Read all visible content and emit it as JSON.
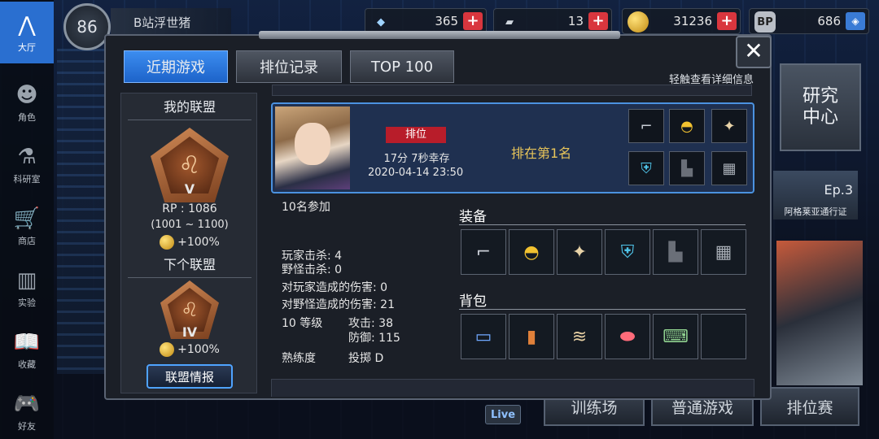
{
  "nav": [
    {
      "label": "大厅",
      "icon": "a-logo-icon",
      "active": true
    },
    {
      "label": "角色",
      "icon": "character-icon"
    },
    {
      "label": "科研室",
      "icon": "flask-icon"
    },
    {
      "label": "商店",
      "icon": "cart-icon"
    },
    {
      "label": "实验",
      "icon": "books-icon"
    },
    {
      "label": "收藏",
      "icon": "book-open-icon"
    },
    {
      "label": "好友",
      "icon": "gamepad-icon"
    }
  ],
  "header": {
    "level": "86",
    "username": "B站浮世猪",
    "resources": [
      {
        "icon": "ticket-icon",
        "value": "365"
      },
      {
        "icon": "card-icon",
        "value": "13"
      },
      {
        "icon": "gold-coin-icon",
        "value": "31236"
      },
      {
        "icon": "bp-icon",
        "value": "686"
      }
    ]
  },
  "background": {
    "research_center": "研究\n中心",
    "episode": "Ep.3",
    "episode_caption": "阿格莱亚通行证",
    "bottom_buttons": [
      "训练场",
      "普通游戏",
      "排位赛"
    ],
    "live": "Live"
  },
  "modal": {
    "tabs": [
      "近期游戏",
      "排位记录",
      "TOP 100"
    ],
    "active_tab": 0,
    "hint": "轻触查看详细信息",
    "close": "✕"
  },
  "league": {
    "my_title": "我的联盟",
    "my_tier": "V",
    "rp": "RP : 1086",
    "rp_range": "(1001 ~ 1100)",
    "my_bonus": "+100%",
    "next_title": "下个联盟",
    "next_tier": "IV",
    "next_bonus": "+100%",
    "info_button": "联盟情报"
  },
  "match": {
    "mode": "排位",
    "survive": "17分 7秒幸存",
    "datetime": "2020-04-14 23:50",
    "placement": "排在第1名",
    "card_slots": [
      "revolver-icon",
      "helmet-icon",
      "amulet-icon",
      "armor-icon",
      "boots-icon",
      "gauntlet-icon"
    ],
    "participants": "10名参加",
    "player_kills": "玩家击杀: 4",
    "monster_kills": "野怪击杀: 0",
    "dmg_players": "对玩家造成的伤害: 0",
    "dmg_monsters": "对野怪造成的伤害: 21",
    "level": "10 等级",
    "attack": "攻击: 38",
    "defense": "防御: 115",
    "proficiency_label": "熟练度",
    "proficiency_value": "投掷 D",
    "equipment_title": "装备",
    "equipment": [
      "revolver-icon",
      "helmet-icon",
      "amulet-icon",
      "armor-icon",
      "boots-icon",
      "gauntlet-icon"
    ],
    "backpack_title": "背包",
    "backpack": [
      "battery-icon",
      "lighter-icon",
      "scroll-icon",
      "pills-icon",
      "laptop-icon",
      ""
    ]
  }
}
